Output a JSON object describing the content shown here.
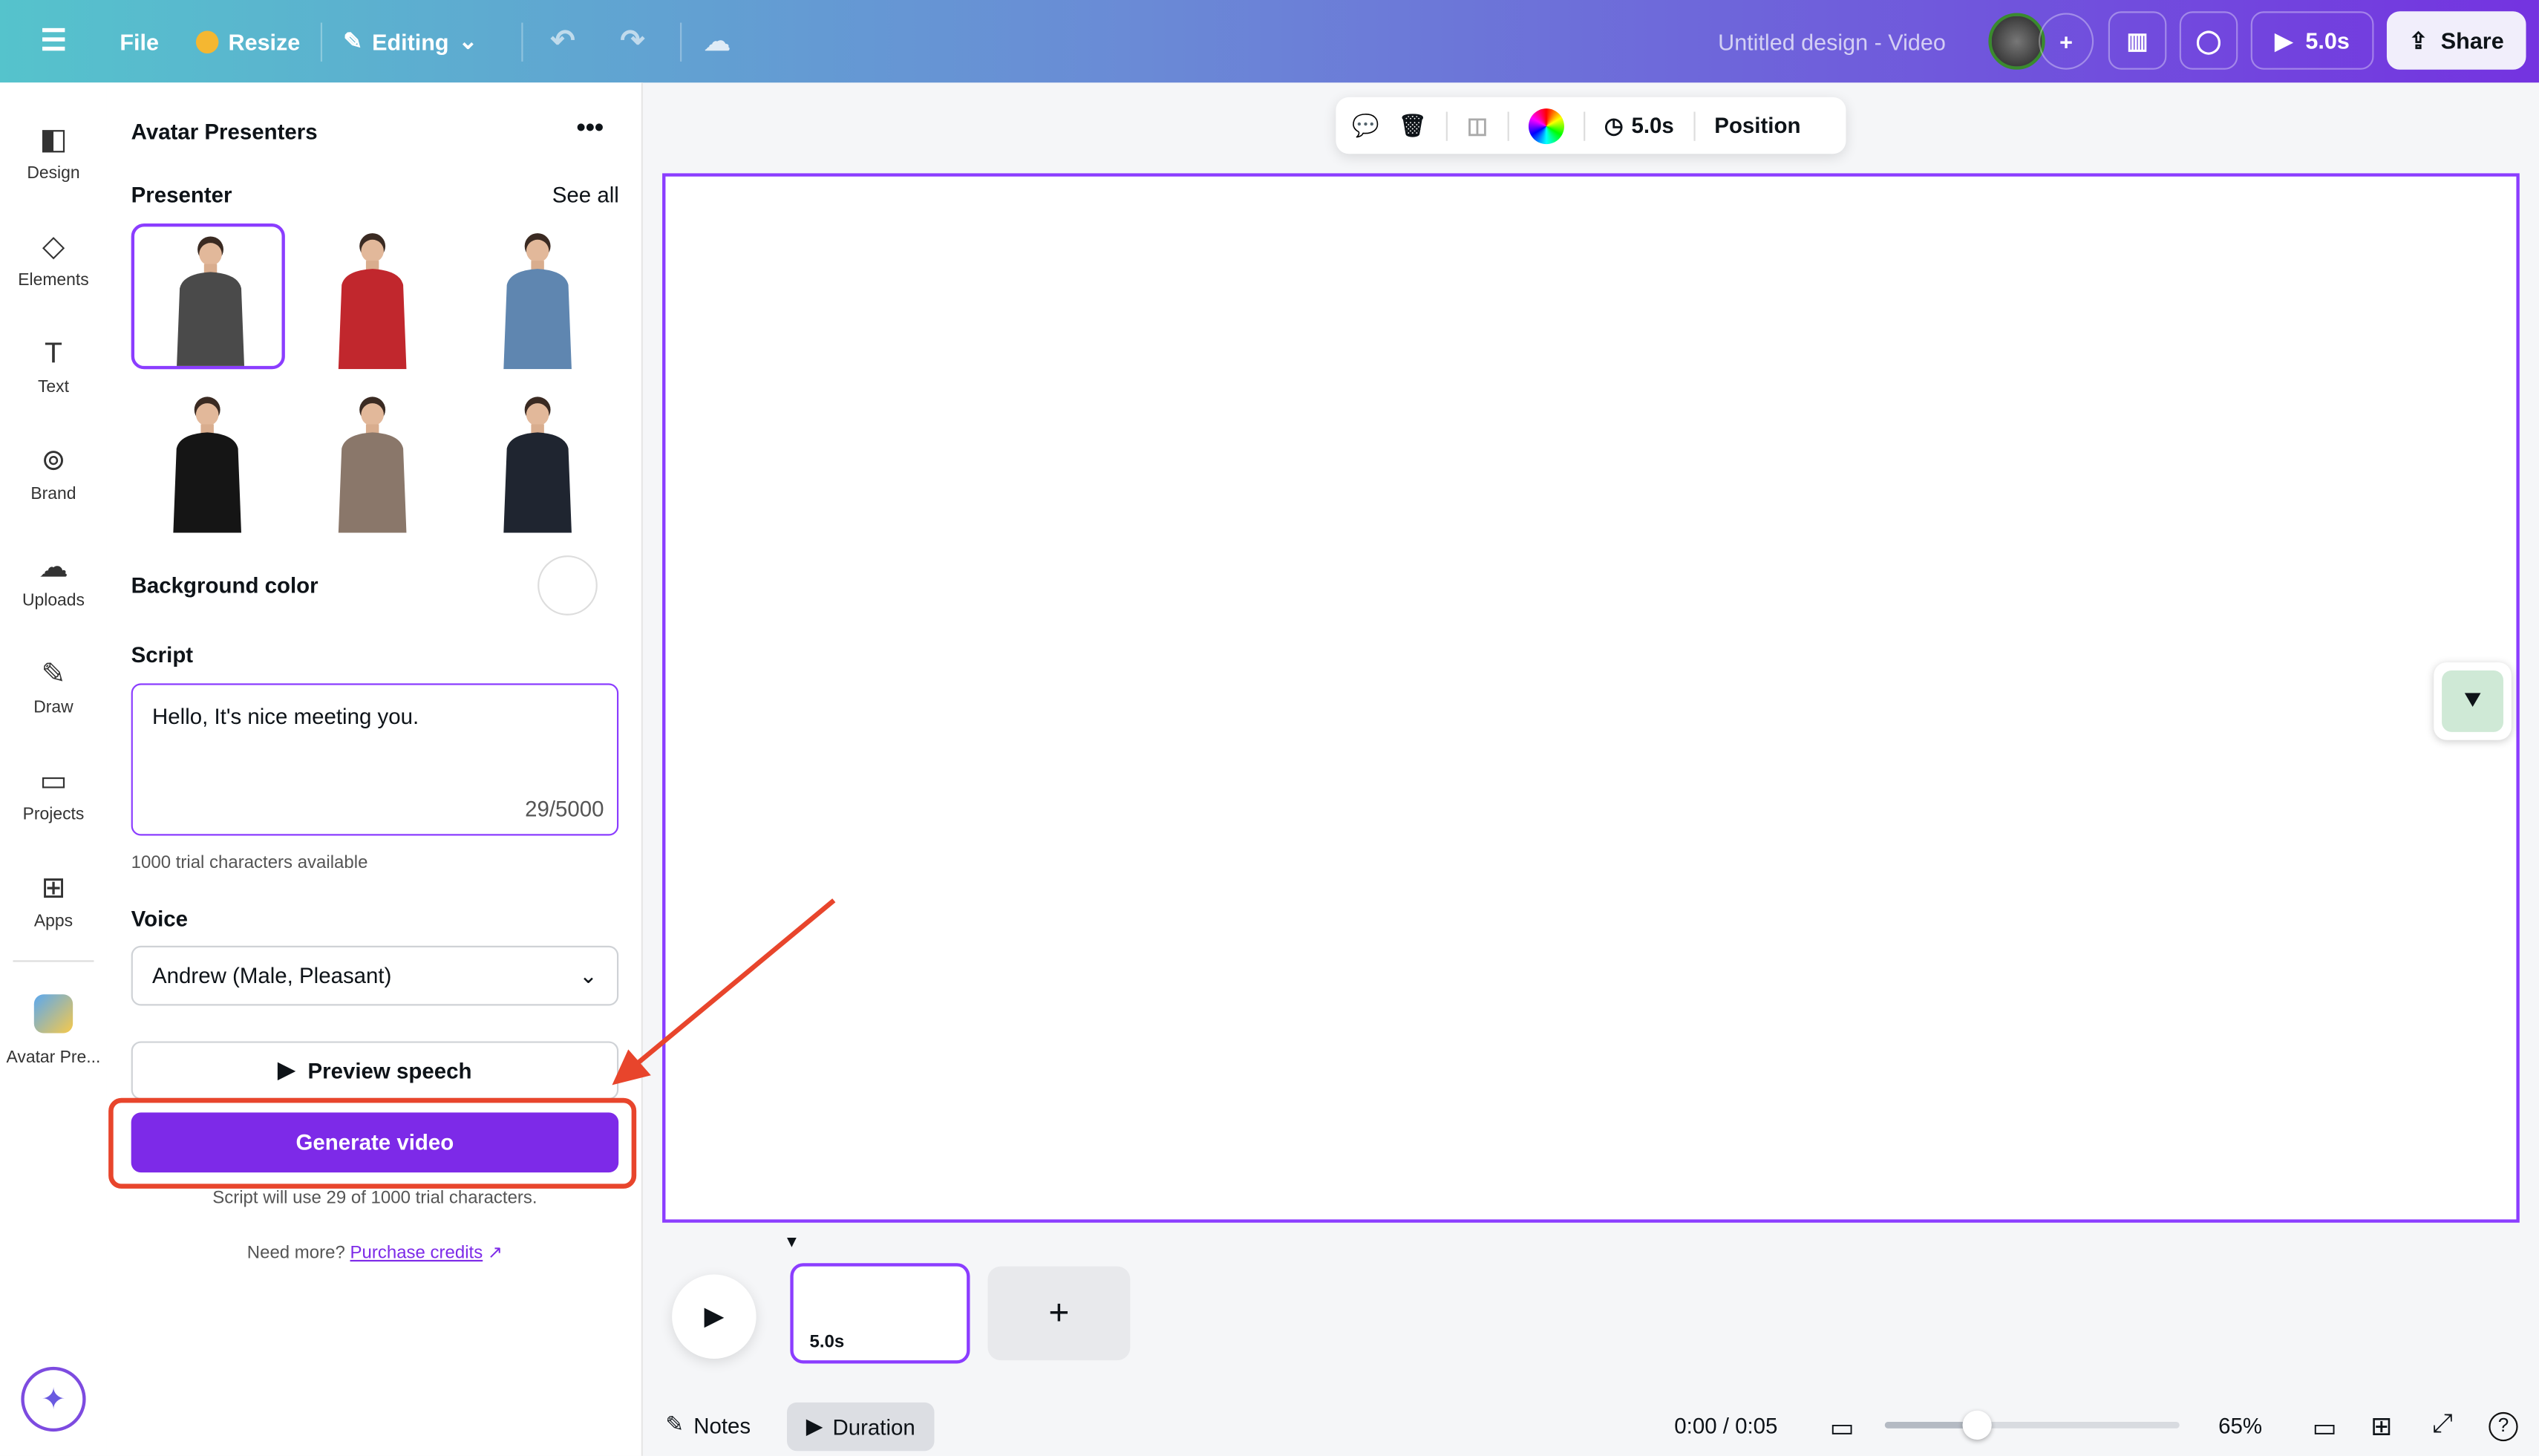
{
  "topbar": {
    "file": "File",
    "resize": "Resize",
    "editing": "Editing",
    "title": "Untitled design - Video",
    "play_duration": "5.0s",
    "share": "Share"
  },
  "rail": [
    {
      "label": "Design",
      "icon": "layout-icon"
    },
    {
      "label": "Elements",
      "icon": "shapes-icon"
    },
    {
      "label": "Text",
      "icon": "text-icon"
    },
    {
      "label": "Brand",
      "icon": "brand-icon"
    },
    {
      "label": "Uploads",
      "icon": "cloud-upload-icon"
    },
    {
      "label": "Draw",
      "icon": "pen-icon"
    },
    {
      "label": "Projects",
      "icon": "folder-icon"
    },
    {
      "label": "Apps",
      "icon": "apps-icon"
    },
    {
      "label": "Avatar Pre...",
      "icon": "avatar-app-icon"
    }
  ],
  "panel": {
    "title": "Avatar Presenters",
    "presenter_label": "Presenter",
    "see_all": "See all",
    "presenters": [
      {
        "shirt": "#4a4a4a",
        "selected": true
      },
      {
        "shirt": "#c1272d"
      },
      {
        "shirt": "#5f86b0"
      },
      {
        "shirt": "#151515"
      },
      {
        "shirt": "#8a776a"
      },
      {
        "shirt": "#1f2530"
      }
    ],
    "background_label": "Background color",
    "script_label": "Script",
    "script_text": "Hello, It's nice meeting you.",
    "char_count": "29/5000",
    "trial_note": "1000 trial characters available",
    "voice_label": "Voice",
    "voice_value": "Andrew (Male, Pleasant)",
    "preview_label": "Preview speech",
    "generate_label": "Generate video",
    "usage_note": "Script will use 29 of 1000 trial characters.",
    "need_more": "Need more?",
    "purchase": "Purchase credits"
  },
  "toolbar": {
    "duration": "5.0s",
    "position": "Position"
  },
  "timeline": {
    "clip_duration": "5.0s",
    "notes": "Notes",
    "duration": "Duration",
    "time": "0:00 / 0:05",
    "zoom": "65%",
    "zoom_percent": 65
  },
  "colors": {
    "accent": "#7d2ae8",
    "annotation": "#e8452c"
  }
}
